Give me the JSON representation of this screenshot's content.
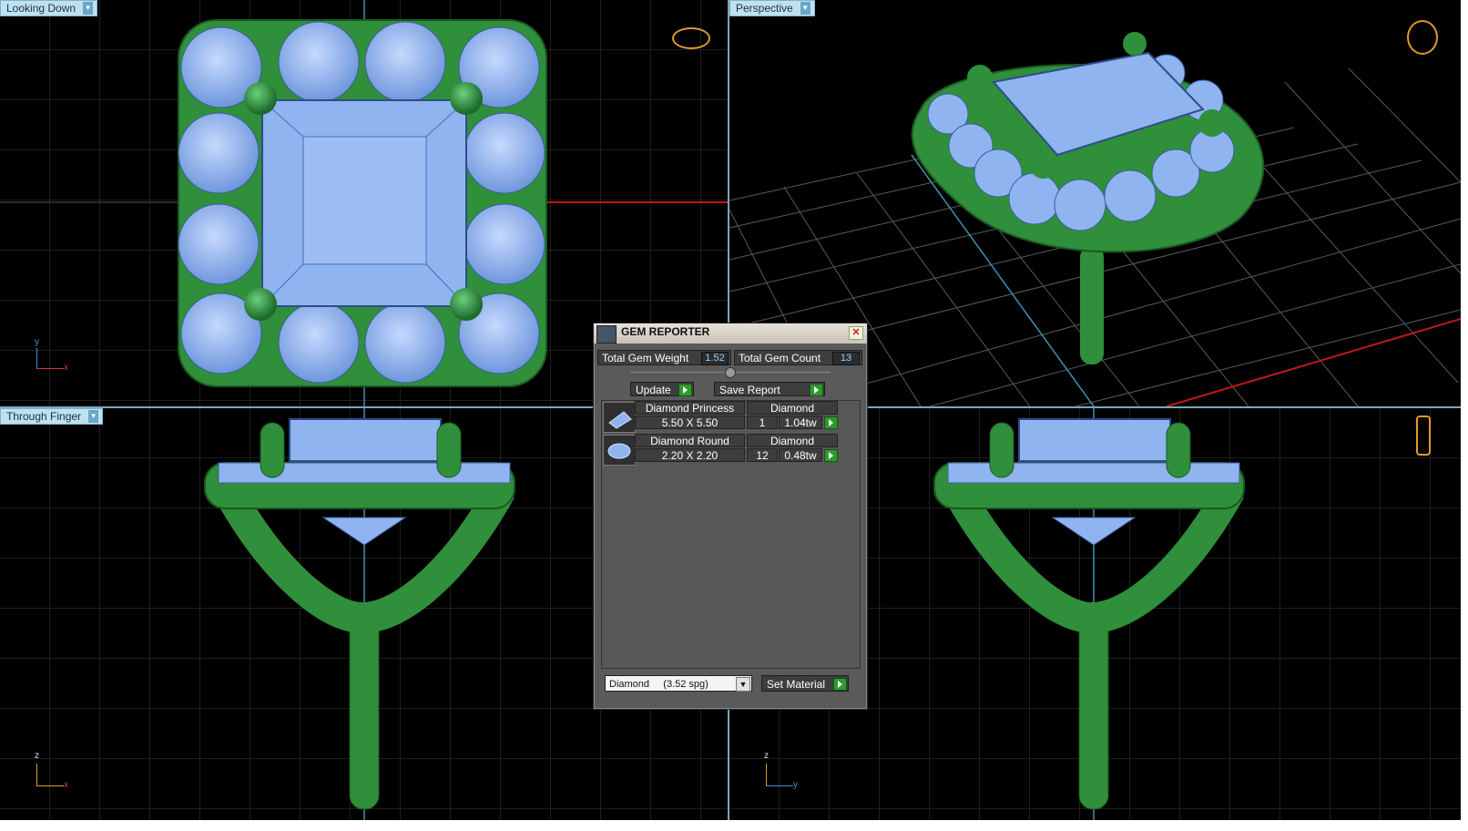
{
  "viewports": {
    "top_left": {
      "label": "Looking Down",
      "axes": [
        "y",
        "x"
      ]
    },
    "top_right": {
      "label": "Perspective"
    },
    "bottom_left": {
      "label": "Through Finger",
      "axes": [
        "z",
        "x"
      ]
    },
    "bottom_right": {
      "axes": [
        "z",
        "y"
      ]
    }
  },
  "gem_reporter": {
    "title": "GEM REPORTER",
    "total_weight_label": "Total Gem Weight",
    "total_weight_value": "1.52",
    "total_count_label": "Total Gem Count",
    "total_count_value": "13",
    "update_label": "Update",
    "save_report_label": "Save Report",
    "gems": [
      {
        "name": "Diamond Princess",
        "material": "Diamond",
        "size": "5.50 X 5.50",
        "count": "1",
        "weight": "1.04tw"
      },
      {
        "name": "Diamond Round",
        "material": "Diamond",
        "size": "2.20 X 2.20",
        "count": "12",
        "weight": "0.48tw"
      }
    ],
    "material_select": "Diamond     (3.52 spg)",
    "set_material_label": "Set Material"
  },
  "colors": {
    "metal": "#2f8f3a",
    "gem": "#8fb4f0",
    "grid": "#3a3a3a",
    "accent": "#66b4d8"
  }
}
